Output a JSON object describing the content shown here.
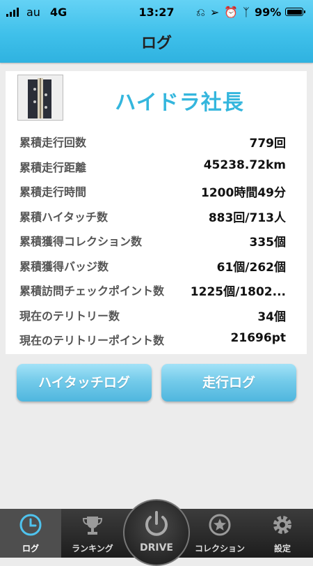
{
  "status_bar": {
    "carrier": "au",
    "network": "4G",
    "time": "13:27",
    "battery": "99%"
  },
  "header": {
    "title": "ログ"
  },
  "profile": {
    "name": "ハイドラ社長"
  },
  "stats": [
    {
      "label": "累積走行回数",
      "value": "779回"
    },
    {
      "label": "累積走行距離",
      "value": "45238.72km"
    },
    {
      "label": "累積走行時間",
      "value": "1200時間49分"
    },
    {
      "label": "累積ハイタッチ数",
      "value": "883回/713人"
    },
    {
      "label": "累積獲得コレクション数",
      "value": "335個"
    },
    {
      "label": "累積獲得バッジ数",
      "value": "61個/262個"
    },
    {
      "label": "累積訪問チェックポイント数",
      "value": "1225個/1802..."
    },
    {
      "label": "現在のテリトリー数",
      "value": "34個"
    },
    {
      "label": "現在のテリトリーポイント数",
      "value": "21696pt"
    }
  ],
  "buttons": {
    "hightouch_log": "ハイタッチログ",
    "run_log": "走行ログ"
  },
  "tabbar": {
    "log": "ログ",
    "ranking": "ランキング",
    "drive": "DRIVE",
    "collection": "コレクション",
    "settings": "設定"
  },
  "colors": {
    "header": "#3fc0ea",
    "accent": "#34b6dd",
    "tabbar": "#1d1d1d"
  }
}
